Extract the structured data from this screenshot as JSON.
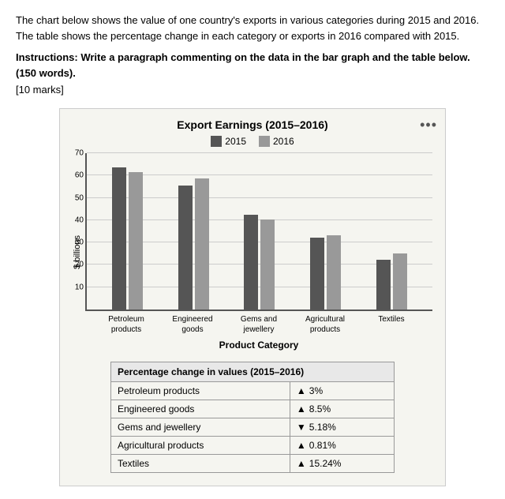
{
  "description": "The chart below shows the value of one country's exports in various categories during 2015 and 2016. The table shows the percentage change in each category or exports in 2016 compared with 2015.",
  "instructions": "Instructions: Write a paragraph commenting on the data in the bar graph and the table below. (150 words).",
  "marks": "[10 marks]",
  "chart": {
    "title": "Export Earnings (2015–2016)",
    "legend": {
      "label2015": "2015",
      "label2016": "2016"
    },
    "yAxisLabel": "$ billions",
    "xAxisTitle": "Product Category",
    "yTicks": [
      10,
      20,
      30,
      40,
      50,
      60,
      70
    ],
    "maxValue": 70,
    "categories": [
      {
        "label": "Petroleum\nproducts",
        "val2015": 63,
        "val2016": 61
      },
      {
        "label": "Engineered\ngoods",
        "val2015": 55,
        "val2016": 58
      },
      {
        "label": "Gems and\njewellery",
        "val2015": 42,
        "val2016": 40
      },
      {
        "label": "Agricultural\nproducts",
        "val2015": 32,
        "val2016": 33
      },
      {
        "label": "Textiles",
        "val2015": 22,
        "val2016": 25
      }
    ]
  },
  "table": {
    "header": "Percentage change in values (2015–2016)",
    "rows": [
      {
        "category": "Petroleum products",
        "direction": "up",
        "value": "3%"
      },
      {
        "category": "Engineered goods",
        "direction": "up",
        "value": "8.5%"
      },
      {
        "category": "Gems and jewellery",
        "direction": "down",
        "value": "5.18%"
      },
      {
        "category": "Agricultural products",
        "direction": "up",
        "value": "0.81%"
      },
      {
        "category": "Textiles",
        "direction": "up",
        "value": "15.24%"
      }
    ]
  },
  "moreButton": "•••"
}
